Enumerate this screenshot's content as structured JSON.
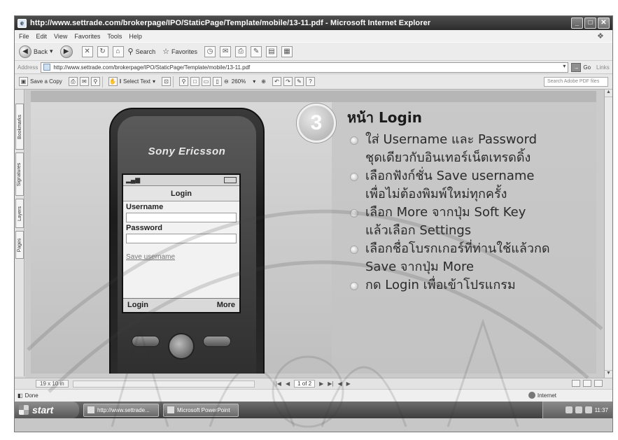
{
  "window": {
    "title": "http://www.settrade.com/brokerpage/IPO/StaticPage/Template/mobile/13-11.pdf - Microsoft Internet Explorer",
    "minimize": "_",
    "maximize": "□",
    "close": "✕"
  },
  "menu": [
    "File",
    "Edit",
    "View",
    "Favorites",
    "Tools",
    "Help"
  ],
  "nav": {
    "back": "Back",
    "search": "Search",
    "favorites": "Favorites"
  },
  "address": {
    "label": "Address",
    "url": "http://www.settrade.com/brokerpage/IPO/StaticPage/Template/mobile/13-11.pdf",
    "go": "Go",
    "links": "Links"
  },
  "pdf_toolbar": {
    "save_copy": "Save a Copy",
    "select_text": "Select Text",
    "zoom": "260%",
    "search_placeholder": "Search Adobe PDF files"
  },
  "nav_tabs": [
    "Bookmarks",
    "Signatures",
    "Layers",
    "Pages"
  ],
  "slide": {
    "step_number": "3",
    "phone": {
      "brand": "Sony Ericsson",
      "screen_title": "Login",
      "username_label": "Username",
      "password_label": "Password",
      "save_option": "Save username",
      "softkey_left": "Login",
      "softkey_right": "More"
    },
    "heading": "หน้า Login",
    "bullets": [
      {
        "line1": "ใส่ Username และ Password",
        "line2": "ชุดเดียวกับอินเทอร์เน็ตเทรดดิ้ง"
      },
      {
        "line1": "เลือกฟังก์ชั่น Save username",
        "line2": "เพื่อไม่ต้องพิมพ์ใหม่ทุกครั้ง"
      },
      {
        "line1": "เลือก More จากปุ่ม Soft Key",
        "line2": "แล้วเลือก Settings"
      },
      {
        "line1": "เลือกชื่อโบรกเกอร์ที่ท่านใช้แล้วกด",
        "line2": "Save จากปุ่ม More"
      },
      {
        "line1": "กด Login เพื่อเข้าโปรแกรม",
        "line2": ""
      }
    ]
  },
  "pdf_status": {
    "page_size": "19 x 10 in",
    "page": "1 of 2"
  },
  "ie_status": {
    "state": "Done",
    "zone": "Internet"
  },
  "taskbar": {
    "start": "start",
    "task1": "http://www.settrade...",
    "task2": "Microsoft PowerPoint",
    "time": "11:37"
  }
}
